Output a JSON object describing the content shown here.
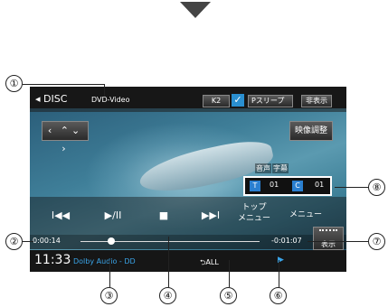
{
  "top_marker": "down-arrow",
  "player": {
    "source": "DISC",
    "media_type": "DVD-Video",
    "k2_label": "K2",
    "k2_checked": true,
    "sleep_label": "Pスリープ",
    "hide_label": "非表示",
    "nav_label": "‹ ⌃⌄ ›",
    "video_adjust_label": "映像調整",
    "audio_label": "音声",
    "subtitle_label": "字幕",
    "title_badge": "T",
    "title_number": "01",
    "chapter_badge": "C",
    "chapter_number": "01",
    "prev_label": "I◀◀",
    "play_pause_label": "▶/II",
    "stop_label": "■",
    "next_label": "▶▶I",
    "top_menu_label": "トップ\nメニュー",
    "menu_label": "メニュー",
    "elapsed_time": "0:00:14",
    "remaining_time": "-0:01:07",
    "progress_fraction": 0.17,
    "display_label": "表示",
    "clock": "11:33",
    "audio_format": "Dolby Audio - DD",
    "repeat_mode": "ALL",
    "play_state_icon": "▶"
  },
  "callouts": {
    "c1": "①",
    "c2": "②",
    "c3": "③",
    "c4": "④",
    "c5": "⑤",
    "c6": "⑥",
    "c7": "⑦",
    "c8": "⑧"
  },
  "colors": {
    "accent_blue": "#3aa4e8",
    "screen_bg": "#111111"
  }
}
